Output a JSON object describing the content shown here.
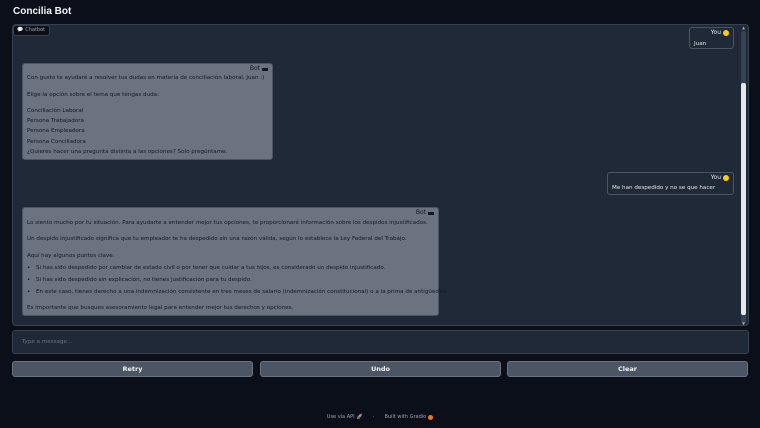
{
  "app_title": "Concilia Bot",
  "chatbot_label": "Chatbot",
  "messages": [
    {
      "role": "You",
      "lines": [
        "Juan"
      ]
    },
    {
      "role": "Bot",
      "lines": [
        "Con gusto te ayudaré a resolver tus dudas en materia de conciliación laboral, Juan :)",
        "Elige la opción sobre el tema que tengas duda:",
        "Conciliación Laboral",
        "Persona Trabajadora",
        "Persona Empleadora",
        "Persona Conciliadora",
        "¿Quieres hacer una pregunta distinta a las opciones? Solo pregúntame."
      ]
    },
    {
      "role": "You",
      "lines": [
        "Me han despedido y no se que hacer"
      ]
    },
    {
      "role": "Bot",
      "lines": [
        "Lo siento mucho por tu situación. Para ayudarte a entender mejor tus opciones, te proporcionaré información sobre los despidos injustificados.",
        "Un despido injustificado significa que tu empleador te ha despedido sin una razón válida, según lo establece la Ley Federal del Trabajo.",
        "Aquí hay algunos puntos clave:",
        "Si has sido despedido por cambiar de estado civil o por tener que cuidar a tus hijos, es considerado un despido injustificado.",
        "Si has sido despedido sin explicación, no tienes justificación para tu despido.",
        "En este caso, tienes derecho a una indemnización consistente en tres meses de salario (indemnización constitucional) o a la prima de antigüedad.",
        "Es importante que busques asesoramiento legal para entender mejor tus derechos y opciones."
      ]
    }
  ],
  "input": {
    "placeholder": "Type a message..."
  },
  "buttons": {
    "retry": "Retry",
    "undo": "Undo",
    "clear": "Clear"
  },
  "footer": {
    "api": "Use via API",
    "built": "Built with Gradio"
  },
  "colors": {
    "background": "#0b0f19",
    "panel": "#1f2937",
    "bot_bubble": "#6b7280",
    "button": "#4b5563"
  }
}
